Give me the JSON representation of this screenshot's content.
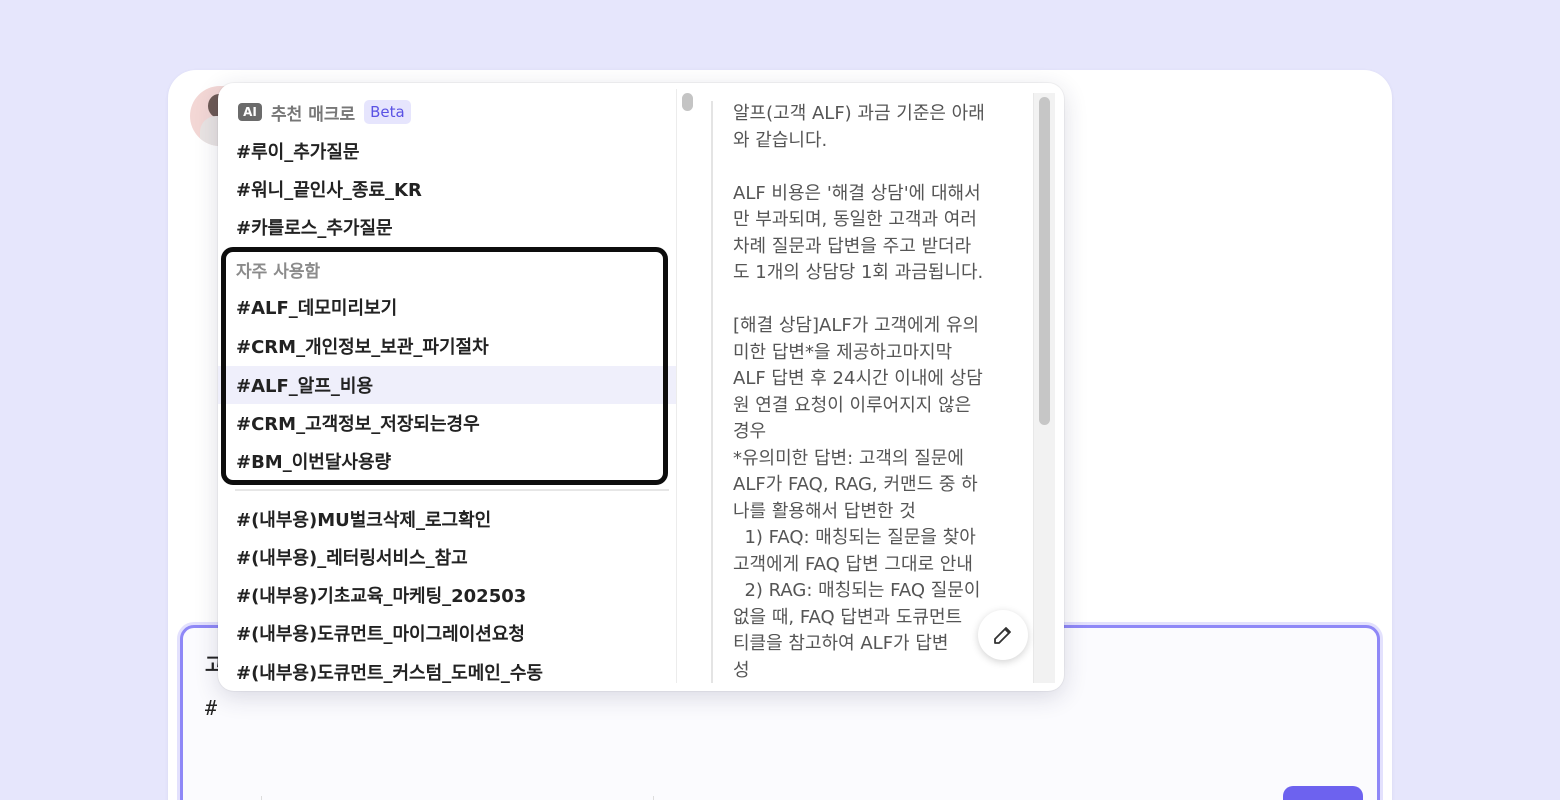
{
  "composer": {
    "label_fragment": "고",
    "input_text": "#"
  },
  "popup": {
    "header": {
      "ai_badge": "AI",
      "title": "추천 매크로",
      "beta_badge": "Beta"
    },
    "recommended_items": [
      "#루이_추가질문",
      "#워니_끝인사_종료_KR",
      "#카를로스_추가질문"
    ],
    "frequent_section_label": "자주 사용함",
    "frequent_items": [
      "#ALF_데모미리보기",
      "#CRM_개인정보_보관_파기절차",
      "#ALF_알프_비용",
      "#CRM_고객정보_저장되는경우",
      "#BM_이번달사용량"
    ],
    "active_item": "#ALF_알프_비용",
    "other_items": [
      "#(내부용)MU벌크삭제_로그확인",
      "#(내부용)_레터링서비스_참고",
      "#(내부용)기초교육_마케팅_202503",
      "#(내부용)도큐먼트_마이그레이션요청",
      "#(내부용)도큐먼트_커스텀_도메인_수동"
    ],
    "preview_text": "알프(고객 ALF) 과금 기준은 아래\n와 같습니다.\n\nALF 비용은 '해결 상담'에 대해서\n만 부과되며, 동일한 고객과 여러\n차례 질문과 답변을 주고 받더라\n도 1개의 상담당 1회 과금됩니다.\n\n[해결 상담]ALF가 고객에게 유의\n미한 답변*을 제공하고마지막\nALF 답변 후 24시간 이내에 상담\n원 연결 요청이 이루어지지 않은\n경우\n*유의미한 답변: 고객의 질문에\nALF가 FAQ, RAG, 커맨드 중 하\n나를 활용해서 답변한 것\n  1) FAQ: 매칭되는 질문을 찾아\n고객에게 FAQ 답변 그대로 안내\n  2) RAG: 매칭되는 FAQ 질문이\n없을 때, FAQ 답변과 도큐먼트\n티클을 참고하여 ALF가 답변\n성"
  },
  "colors": {
    "background": "#e6e6fc",
    "accent": "#6d62ef",
    "highlight_border": "#0d0d0d",
    "active_row": "#efeffb"
  },
  "icons": {
    "edit": "pencil-edit-icon",
    "ai": "ai-badge-icon"
  }
}
